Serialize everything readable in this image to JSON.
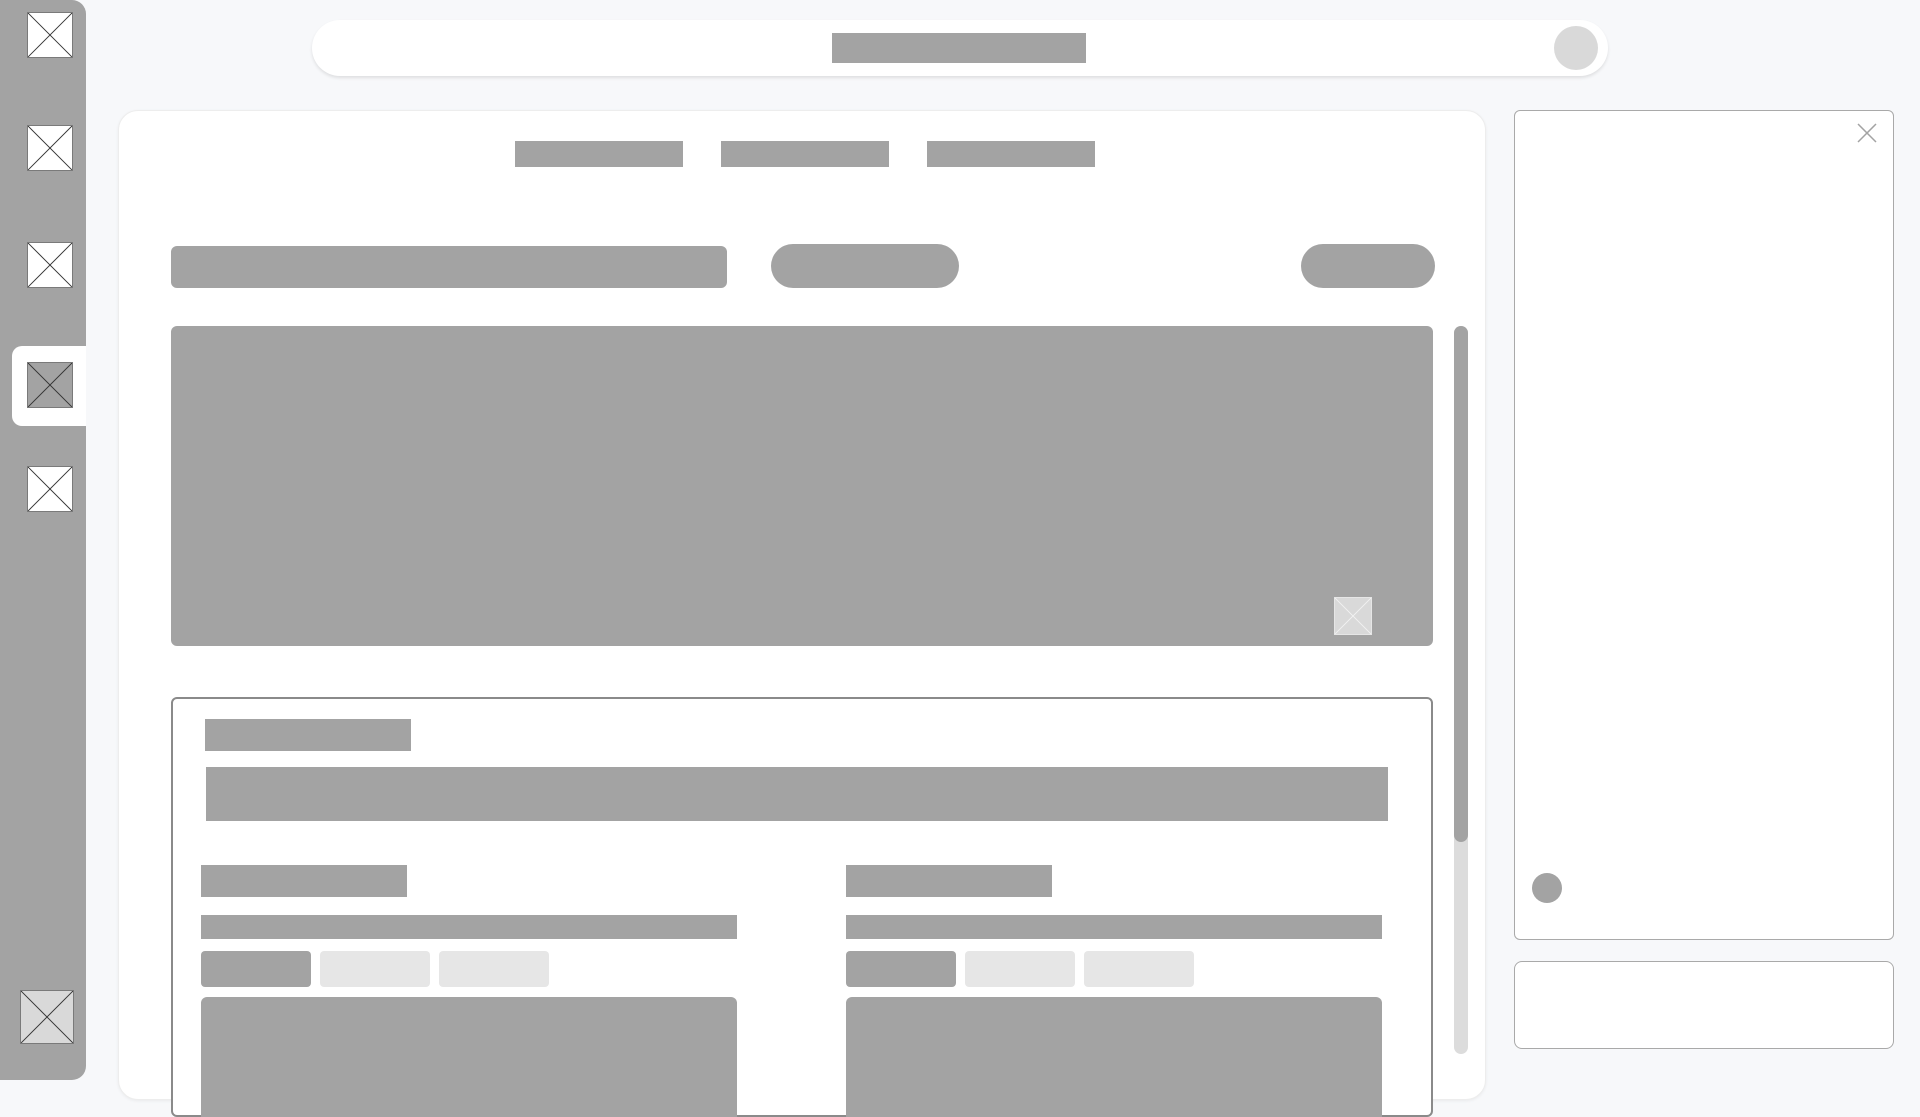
{
  "sidebar": {
    "items": [
      {
        "icon": "placeholder-image-icon",
        "active": false
      },
      {
        "icon": "placeholder-image-icon",
        "active": false
      },
      {
        "icon": "placeholder-image-icon",
        "active": false
      },
      {
        "icon": "placeholder-image-icon",
        "active": true
      },
      {
        "icon": "placeholder-image-icon",
        "active": false
      }
    ],
    "bottom_item": {
      "icon": "placeholder-image-icon"
    }
  },
  "topbar": {
    "avatar_icon": "avatar-icon"
  },
  "main": {
    "tabs": [
      "",
      "",
      ""
    ],
    "hero": {
      "icon": "placeholder-image-icon"
    }
  },
  "right_panel": {
    "close_icon": "close-icon"
  },
  "colors": {
    "background": "#f7f8fa",
    "placeholder": "#a3a3a3",
    "placeholder_light": "#e6e6e6",
    "surface": "#ffffff"
  }
}
